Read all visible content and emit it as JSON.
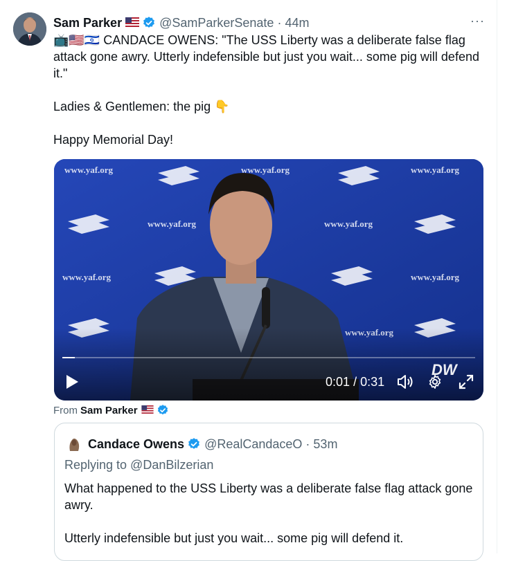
{
  "tweet": {
    "author_name": "Sam Parker",
    "author_flag": "🇺🇸",
    "handle": "@SamParkerSenate",
    "separator": "·",
    "time": "44m",
    "more_label": "···",
    "text_line1_prefix": "📺🇺🇸🇮🇱 ",
    "text_line1": "CANDACE OWENS: \"The USS Liberty was a deliberate false flag attack gone awry. Utterly indefensible but just you wait... some pig will defend it.\"",
    "text_line2": "Ladies & Gentlemen: the pig 👇",
    "text_line3": "Happy Memorial Day!"
  },
  "video": {
    "watermark": "www.yaf.org",
    "current_time": "0:01",
    "time_separator": "/",
    "duration": "0:31",
    "progress_fraction": 0.03,
    "channel_logo": "DW",
    "icons": [
      "play-icon",
      "volume-icon",
      "gear-icon",
      "expand-icon"
    ]
  },
  "from": {
    "label": "From",
    "name": "Sam Parker",
    "flag": "🇺🇸"
  },
  "quote": {
    "author_name": "Candace Owens",
    "handle": "@RealCandaceO",
    "separator": "·",
    "time": "53m",
    "replying_to": "Replying to @DanBilzerian",
    "text_para1": "What happened to the USS Liberty was a deliberate false flag attack gone awry.",
    "text_para2": "Utterly indefensible but just you wait... some pig will defend it."
  },
  "colors": {
    "verified_blue": "#1d9bf0",
    "secondary_text": "#536471",
    "video_backdrop": "#1c3aa0"
  }
}
